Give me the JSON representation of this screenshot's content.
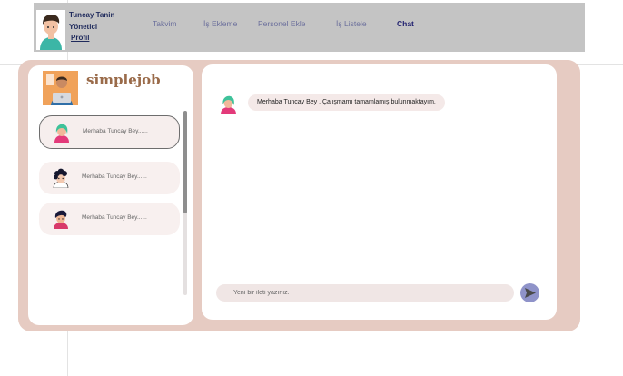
{
  "user": {
    "name": "Tuncay Tanin",
    "role": "Yönetici",
    "profile_link": "Profil"
  },
  "nav": {
    "items": [
      {
        "label": "Takvim",
        "active": false
      },
      {
        "label": "İş Ekleme",
        "active": false
      },
      {
        "label": "Personel Ekle",
        "active": false
      },
      {
        "label": "İş Listele",
        "active": false
      },
      {
        "label": "Chat",
        "active": true
      }
    ]
  },
  "brand": {
    "name": "simplejob"
  },
  "conversations": [
    {
      "preview": "Merhaba Tuncay Bey......",
      "selected": true,
      "avatar_icon": "green-hair-avatar-icon"
    },
    {
      "preview": "Merhaba Tuncay Bey......",
      "selected": false,
      "avatar_icon": "curly-hair-avatar-icon"
    },
    {
      "preview": "Merhaba Tuncay Bey......",
      "selected": false,
      "avatar_icon": "dark-hair-avatar-icon"
    }
  ],
  "chat": {
    "messages": [
      {
        "text": "Merhaba Tuncay Bey , Çalışmamı tamamlamış bulunmaktayım."
      }
    ],
    "input_placeholder": "Yeni bir ileti yazınız."
  },
  "colors": {
    "nav_bg": "#c4c4c4",
    "accent_navy": "#1e1e6e",
    "container_bg": "#e6cbc2",
    "send_button": "#8f93c9"
  }
}
